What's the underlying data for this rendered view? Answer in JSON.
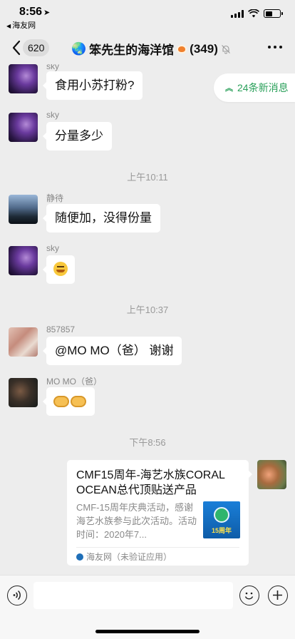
{
  "status": {
    "time": "8:56",
    "location_arrow": "➤",
    "back_app": "海友网",
    "back_arrow": "◀"
  },
  "nav": {
    "back_count": "620",
    "globe": "🌏",
    "title": "笨先生的海洋馆",
    "member_count": "(349)"
  },
  "new_messages": "24条新消息",
  "messages": [
    {
      "sender": "sky",
      "text": "食用小苏打粉?"
    },
    {
      "sender": "sky",
      "text": "分量多少"
    },
    {
      "sender": "静待",
      "text": "随便加，没得份量"
    },
    {
      "sender": "sky",
      "text": ""
    },
    {
      "sender": "857857",
      "text": "@MO MO（爸） 谢谢"
    },
    {
      "sender": "MO MO（爸）",
      "text": ""
    }
  ],
  "time_dividers": [
    "上午10:11",
    "上午10:37",
    "下午8:56"
  ],
  "card": {
    "title": "CMF15周年-海艺水族CORAL OCEAN总代顶贴送产品",
    "description": "CMF-15周年庆典活动，感谢海艺水族参与此次活动。活动时间：2020年7...",
    "thumb_label": "15周年",
    "source": "海友网（未验证应用）"
  },
  "icons": {
    "back": "chevron-left-icon",
    "mute": "bell-slash-icon",
    "more": "more-dots-icon",
    "voice": "voice-icon",
    "emoji": "emoji-icon",
    "plus": "plus-icon"
  },
  "colors": {
    "background": "#ededed",
    "new_messages_text": "#2aa05a",
    "bubble": "#ffffff"
  }
}
